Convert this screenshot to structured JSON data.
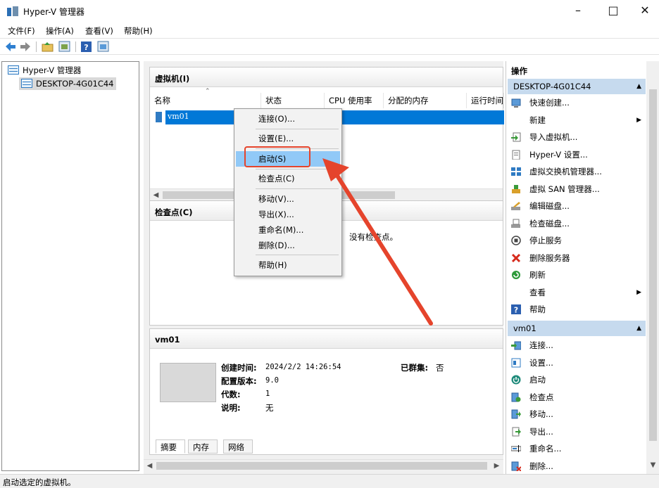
{
  "window": {
    "title": "Hyper-V 管理器",
    "minimize_icon": "minimize-icon",
    "maximize_icon": "maximize-icon",
    "close_icon": "close-icon"
  },
  "menu": [
    "文件(F)",
    "操作(A)",
    "查看(V)",
    "帮助(H)"
  ],
  "toolbar": [
    "back-arrow-icon",
    "forward-arrow-icon",
    "folder-up-icon",
    "show-pane-icon",
    "help-icon",
    "console-icon"
  ],
  "tree": {
    "root": "Hyper-V 管理器",
    "server": "DESKTOP-4G01C44"
  },
  "vm_section": {
    "title": "虚拟机(I)",
    "columns": [
      "名称",
      "状态",
      "CPU 使用率",
      "分配的内存",
      "运行时间"
    ],
    "rows": [
      {
        "name": "vm01"
      }
    ]
  },
  "checkpoint_section": {
    "title": "检查点(C)",
    "empty_message": "没有检查点。"
  },
  "details_section": {
    "title": "vm01",
    "created_label": "创建时间:",
    "created_value": "2024/2/2 14:26:54",
    "clustered_label": "已群集:",
    "clustered_value": "否",
    "config_label": "配置版本:",
    "config_value": "9.0",
    "generation_label": "代数:",
    "generation_value": "1",
    "notes_label": "说明:",
    "notes_value": "无",
    "tabs": [
      "摘要",
      "内存",
      "网络"
    ]
  },
  "context_menu": {
    "items": [
      "连接(O)...",
      "设置(E)...",
      "启动(S)",
      "检查点(C)",
      "移动(V)...",
      "导出(X)...",
      "重命名(M)...",
      "删除(D)...",
      "帮助(H)"
    ],
    "highlighted": "启动(S)"
  },
  "actions": {
    "title": "操作",
    "server_group": "DESKTOP-4G01C44",
    "server_items": [
      {
        "label": "快速创建...",
        "icon": "quick-create-icon"
      },
      {
        "label": "新建",
        "icon": "",
        "submenu": true
      },
      {
        "label": "导入虚拟机...",
        "icon": "import-vm-icon"
      },
      {
        "label": "Hyper-V 设置...",
        "icon": "hyperv-settings-icon"
      },
      {
        "label": "虚拟交换机管理器...",
        "icon": "virtual-switch-icon"
      },
      {
        "label": "虚拟 SAN 管理器...",
        "icon": "virtual-san-icon"
      },
      {
        "label": "编辑磁盘...",
        "icon": "edit-disk-icon"
      },
      {
        "label": "检查磁盘...",
        "icon": "inspect-disk-icon"
      },
      {
        "label": "停止服务",
        "icon": "stop-service-icon"
      },
      {
        "label": "删除服务器",
        "icon": "remove-server-icon"
      },
      {
        "label": "刷新",
        "icon": "refresh-icon"
      },
      {
        "label": "查看",
        "icon": "",
        "submenu": true
      },
      {
        "label": "帮助",
        "icon": "help-icon"
      }
    ],
    "vm_group": "vm01",
    "vm_items": [
      {
        "label": "连接...",
        "icon": "connect-icon"
      },
      {
        "label": "设置...",
        "icon": "settings-icon"
      },
      {
        "label": "启动",
        "icon": "start-icon"
      },
      {
        "label": "检查点",
        "icon": "checkpoint-icon"
      },
      {
        "label": "移动...",
        "icon": "move-icon"
      },
      {
        "label": "导出...",
        "icon": "export-icon"
      },
      {
        "label": "重命名...",
        "icon": "rename-icon"
      },
      {
        "label": "删除...",
        "icon": "delete-icon"
      }
    ]
  },
  "status": "启动选定的虚拟机。",
  "colors": {
    "selection": "#0078d7",
    "menu_highlight": "#91c9f7",
    "annotation": "#e5442c",
    "group_header": "#c6daee"
  }
}
